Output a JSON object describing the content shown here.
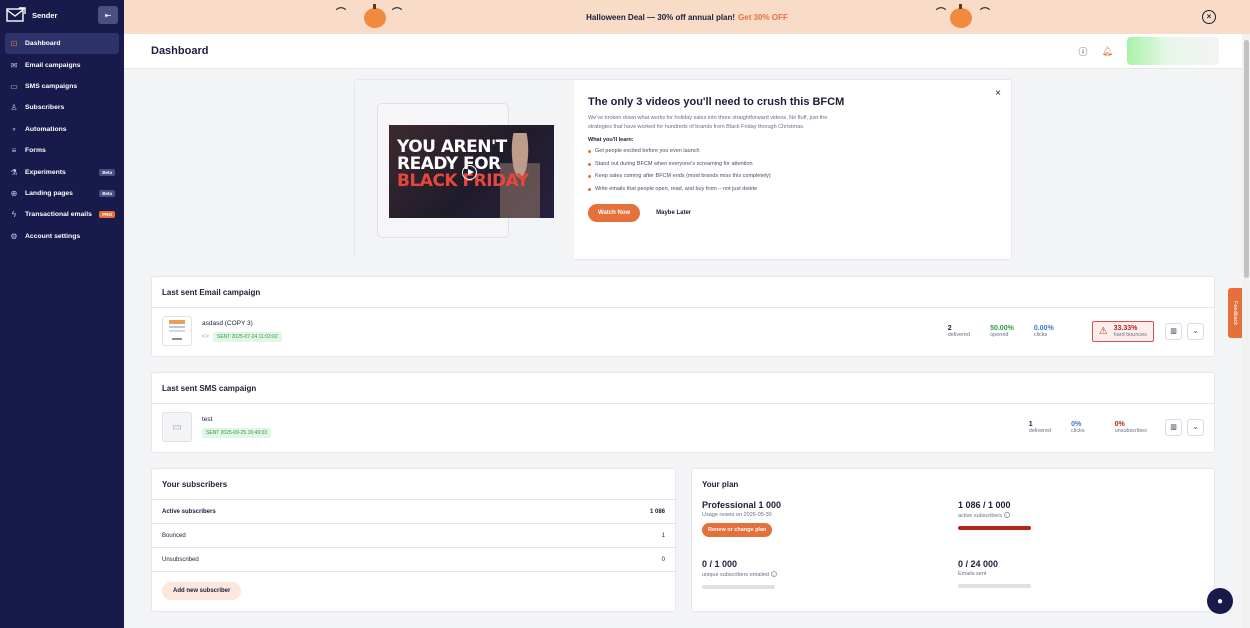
{
  "sidebar": {
    "brand": "Sender",
    "collapse_icon": "collapse-left-icon",
    "items": [
      {
        "label": "Dashboard",
        "icon": "dashboard-icon",
        "active": true
      },
      {
        "label": "Email campaigns",
        "icon": "mail-icon"
      },
      {
        "label": "SMS campaigns",
        "icon": "sms-icon"
      },
      {
        "label": "Subscribers",
        "icon": "subscribers-icon"
      },
      {
        "label": "Automations",
        "icon": "automations-icon"
      },
      {
        "label": "Forms",
        "icon": "forms-icon"
      },
      {
        "label": "Experiments",
        "icon": "flask-icon",
        "badge": "Beta"
      },
      {
        "label": "Landing pages",
        "icon": "globe-icon",
        "badge": "Beta"
      },
      {
        "label": "Transactional emails",
        "icon": "lightning-icon",
        "badge": "PRO"
      },
      {
        "label": "Account settings",
        "icon": "gear-icon"
      }
    ]
  },
  "banner": {
    "text": "Halloween Deal — 30% off annual plan!",
    "cta": "Get 30% OFF"
  },
  "header": {
    "title": "Dashboard"
  },
  "promo": {
    "video_text": [
      "YOU AREN'T",
      "READY FOR",
      "BLACK FRIDAY"
    ],
    "title": "The only 3 videos you'll need to crush this BFCM",
    "description": "We've broken down what works for holiday sales into three straightforward videos. No fluff, just the strategies that have worked for hundreds of brands from Black Friday through Christmas.",
    "learn_heading": "What you'll learn:",
    "points": [
      "Get people excited before you even launch",
      "Stand out during BFCM when everyone's screaming for attention",
      "Keep sales coming after BFCM ends (most brands miss this completely)",
      "Write emails that people open, read, and buy from – not just delete"
    ],
    "watch_now": "Watch Now",
    "maybe_later": "Maybe Later"
  },
  "email_campaign": {
    "section_title": "Last sent Email campaign",
    "name": "asdasd (COPY 3)",
    "sent": "SENT 2025-07-24 11:03:02",
    "delivered_value": "2",
    "delivered_label": "delivered",
    "opened_value": "50.00%",
    "opened_label": "opened",
    "clicks_value": "0.00%",
    "clicks_label": "clicks",
    "bounces_value": "33.33%",
    "bounces_label": "hard bounces"
  },
  "sms_campaign": {
    "section_title": "Last sent SMS campaign",
    "name": "test",
    "sent": "SENT 2025-09-25 16:49:03",
    "delivered_value": "1",
    "delivered_label": "delivered",
    "clicks_value": "0%",
    "clicks_label": "clicks",
    "unsub_value": "0%",
    "unsub_label": "unsubscribes"
  },
  "subscribers": {
    "title": "Your subscribers",
    "rows": [
      {
        "label": "Active subscribers",
        "value": "1 086"
      },
      {
        "label": "Bounced",
        "value": "1"
      },
      {
        "label": "Unsubscribed",
        "value": "0"
      }
    ],
    "add_button": "Add new subscriber"
  },
  "plan": {
    "title": "Your plan",
    "plan_name": "Professional 1 000",
    "resets": "Usage resets on 2026-05-30",
    "renew_button": "Renew or change plan",
    "active_value": "1 086 / 1 000",
    "active_label": "active subscribers",
    "active_fill": 1.0,
    "emailed_value": "0 / 1 000",
    "emailed_label": "unique subscribers emailed",
    "emailed_fill": 0,
    "sent_value": "0 / 24 000",
    "sent_label": "Emails sent",
    "sent_fill": 0
  },
  "feedback_label": "Feedback"
}
